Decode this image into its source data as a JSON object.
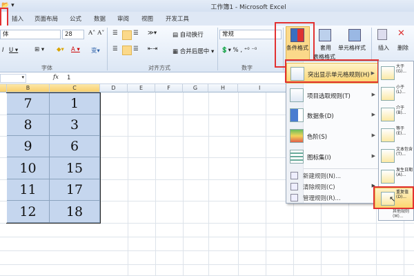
{
  "window": {
    "title": "工作簿1 - Microsoft Excel"
  },
  "tabs": [
    "插入",
    "页面布局",
    "公式",
    "数据",
    "审阅",
    "视图",
    "开发工具"
  ],
  "ribbon": {
    "font": {
      "name": "体",
      "size": "28",
      "group_label": "字体"
    },
    "alignment": {
      "wrap_text": "自动换行",
      "merge_center": "合并后居中",
      "group_label": "对齐方式"
    },
    "number": {
      "format": "常规",
      "group_label": "数字"
    },
    "styles": {
      "conditional_formatting": "条件格式",
      "format_as_table_1": "套用",
      "format_as_table_2": "表格格式",
      "cell_styles": "单元格样式"
    },
    "cells": {
      "insert": "插入",
      "delete": "删除"
    }
  },
  "formula_bar": {
    "fx": "fx",
    "value": "1"
  },
  "columns": [
    "B",
    "C",
    "D",
    "E",
    "F",
    "G",
    "H",
    "I"
  ],
  "rows": [
    [
      "7",
      "1"
    ],
    [
      "8",
      "3"
    ],
    [
      "9",
      "6"
    ],
    [
      "10",
      "15"
    ],
    [
      "11",
      "17"
    ],
    [
      "12",
      "18"
    ]
  ],
  "menu": {
    "items": [
      {
        "label": "突出显示单元格规则(H)",
        "icon": "highlight-rules-icon"
      },
      {
        "label": "项目选取规则(T)",
        "icon": "top-bottom-icon"
      },
      {
        "label": "数据条(D)",
        "icon": "data-bars-icon"
      },
      {
        "label": "色阶(S)",
        "icon": "color-scales-icon"
      },
      {
        "label": "图标集(I)",
        "icon": "icon-sets-icon"
      }
    ],
    "small_items": [
      "新建规则(N)...",
      "清除规则(C)",
      "管理规则(R)..."
    ]
  },
  "submenu": {
    "items": [
      "大于(G)...",
      "小于(L)...",
      "介于(B)...",
      "等于(E)...",
      "文本包含(T)...",
      "发生日期(A)...",
      "重复值(D)..."
    ],
    "more": "其他规则(M)..."
  },
  "colors": {
    "highlight": "#fcd670",
    "selection": "#c5d6ee",
    "annotation": "#e23030"
  }
}
